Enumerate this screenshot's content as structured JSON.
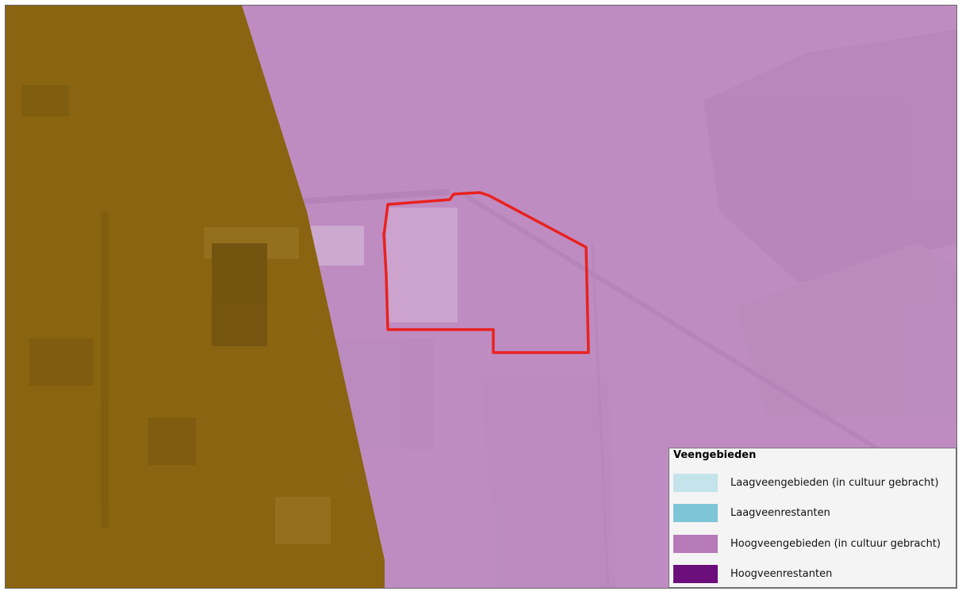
{
  "map": {
    "zones": [
      {
        "name": "uitgesloten-gebied",
        "color": "#8a6410"
      },
      {
        "name": "hoogveengebieden",
        "color": "#bf8cc2"
      }
    ],
    "boundary_color": "#e8221e"
  },
  "legend": {
    "title": "Veengebieden",
    "items": [
      {
        "label": "Laagveengebieden (in cultuur gebracht)",
        "color": "#c4e3ea"
      },
      {
        "label": "Laagveenrestanten",
        "color": "#7fc5d8"
      },
      {
        "label": "Hoogveengebieden (in cultuur gebracht)",
        "color": "#b57ab7"
      },
      {
        "label": "Hoogveenrestanten",
        "color": "#6c0e7c"
      }
    ]
  }
}
